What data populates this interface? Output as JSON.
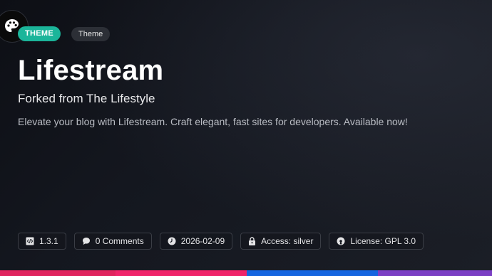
{
  "badges": {
    "primary": "THEME",
    "tag": "Theme"
  },
  "title": "Lifestream",
  "subtitle": "Forked from The Lifestyle",
  "description": "Elevate your blog with Lifestream. Craft elegant, fast sites for developers. Available now!",
  "meta": {
    "version": "1.3.1",
    "comments": "0 Comments",
    "date": "2026-02-09",
    "access": "Access: silver",
    "license": "License: GPL 3.0"
  },
  "icons": {
    "palette": "palette-icon",
    "version": "code-file-icon",
    "comments": "speech-bubble-icon",
    "date": "clock-icon",
    "access": "lock-icon",
    "license": "open-source-icon"
  },
  "colors": {
    "accent": "#1bb59a",
    "bar": [
      "#e0245e",
      "#f0246a",
      "#1565e0",
      "#7b3fc4"
    ]
  }
}
